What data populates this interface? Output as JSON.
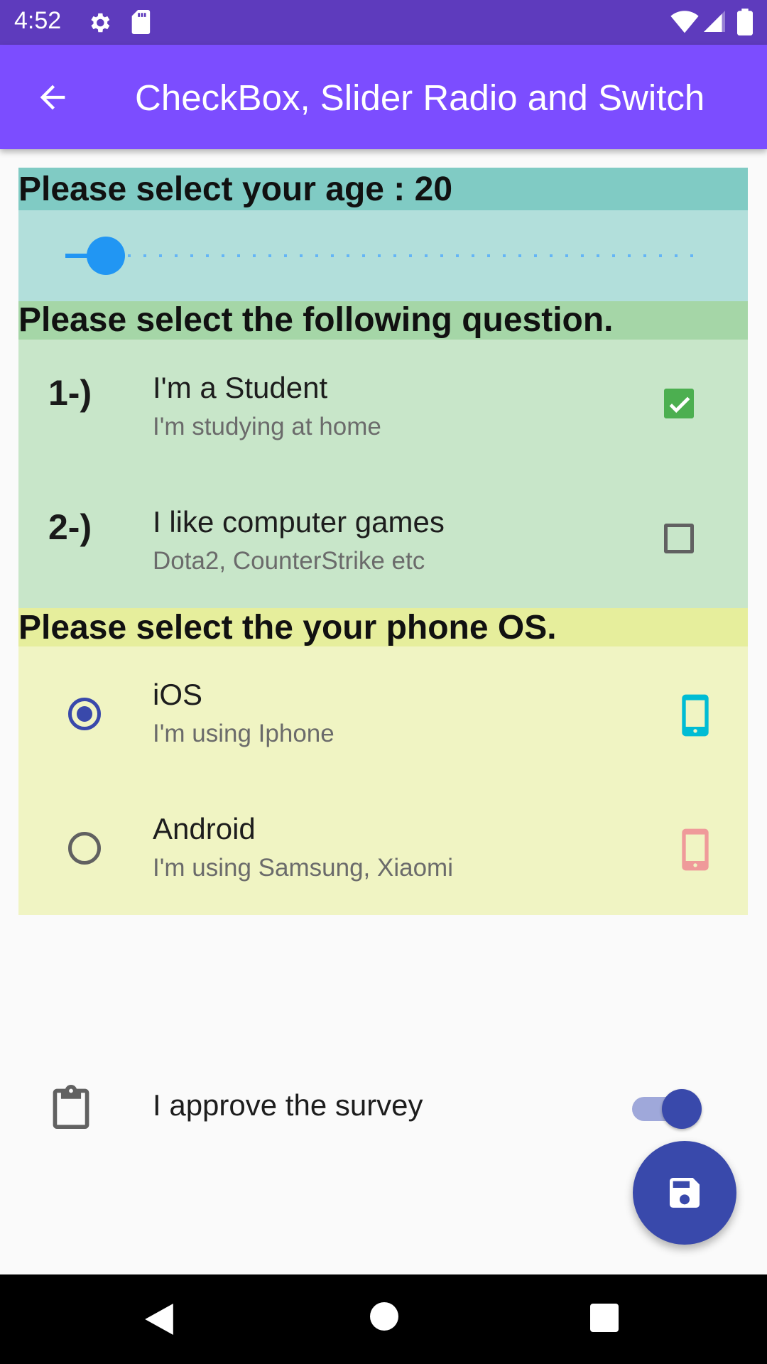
{
  "status_bar": {
    "time": "4:52"
  },
  "app_bar": {
    "title": "CheckBox, Slider Radio and Switch"
  },
  "age_section": {
    "heading": "Please select your age : 20",
    "slider_value": 20,
    "slider_fraction": 0.038,
    "colors": {
      "header_bg": "#80cbc4",
      "body_bg": "#b2dfdb",
      "accent": "#2196f3"
    }
  },
  "question_section": {
    "heading": "Please select the following question.",
    "colors": {
      "header_bg": "#a5d6a7",
      "body_bg": "#c8e6c9",
      "check": "#4caf50"
    },
    "items": [
      {
        "number": "1-)",
        "title": "I'm a Student",
        "subtitle": "I'm studying at home",
        "checked": true
      },
      {
        "number": "2-)",
        "title": "I like computer games",
        "subtitle": "Dota2, CounterStrike etc",
        "checked": false
      }
    ]
  },
  "os_section": {
    "heading": "Please select the your phone OS.",
    "colors": {
      "header_bg": "#e6ee9c",
      "body_bg": "#f0f4c3",
      "radio": "#3949ab"
    },
    "items": [
      {
        "title": "iOS",
        "subtitle": "I'm using Iphone",
        "selected": true,
        "icon": "phone-icon",
        "icon_color": "#00bcd4"
      },
      {
        "title": "Android",
        "subtitle": "I'm using Samsung, Xiaomi",
        "selected": false,
        "icon": "phone-icon",
        "icon_color": "#ef9a9a"
      }
    ]
  },
  "approve": {
    "label": "I approve the survey",
    "switch_on": true,
    "icon": "clipboard-icon"
  },
  "fab": {
    "icon": "save-icon",
    "color": "#3949ab"
  }
}
